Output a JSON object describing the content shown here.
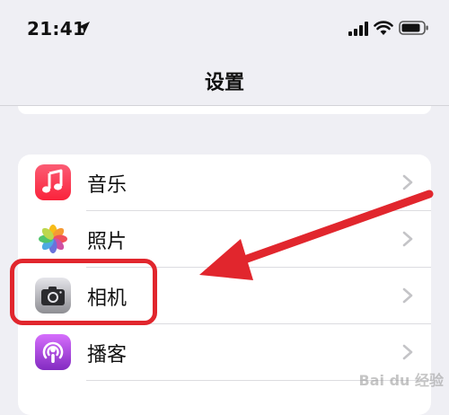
{
  "status_bar": {
    "time": "21:41",
    "icons": [
      "location-arrow-icon",
      "cellular-signal-icon",
      "wifi-icon",
      "battery-icon"
    ]
  },
  "nav": {
    "title": "设置"
  },
  "settings": {
    "rows": [
      {
        "label": "音乐",
        "icon": "music-app-icon",
        "color": "#fa233b"
      },
      {
        "label": "照片",
        "icon": "photos-app-icon",
        "color": "#ffffff"
      },
      {
        "label": "相机",
        "icon": "camera-app-icon",
        "color": "#8e8e93"
      },
      {
        "label": "播客",
        "icon": "podcasts-app-icon",
        "color": "#832bc1"
      }
    ]
  },
  "annotation": {
    "highlight_color": "#e1262d",
    "target_row": "相机"
  },
  "watermark": {
    "text": "Bai du 经验"
  },
  "colors": {
    "background": "#efeff4",
    "card": "#ffffff",
    "chevron": "#c4c4c7"
  }
}
